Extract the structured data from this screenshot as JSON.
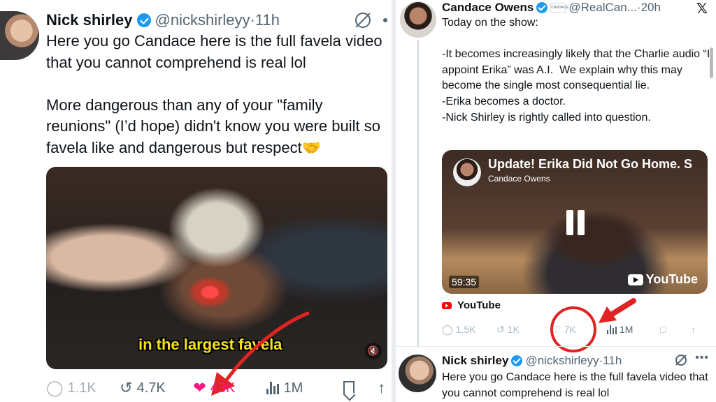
{
  "left_post": {
    "name": "Nick shirley",
    "handle": "@nickshirleyy",
    "time": "·11h",
    "text": "Here you go Candace here is the full favela video that you cannot comprehend is real lol\n\nMore dangerous than any of your \"family reunions\" (I’d hope) didn't know you were built so favela like and dangerous but respect🤝",
    "video_caption": "in the largest favela",
    "actions": {
      "replies": "1.1K",
      "reposts": "4.7K",
      "likes": "43K",
      "views": "1M"
    },
    "colors": {
      "like_active": "#f91880",
      "annotation_arrow": "#e02424"
    },
    "icons": [
      "grok-icon",
      "more-icon",
      "mute-icon",
      "reply-icon",
      "repost-icon",
      "heart-filled-icon",
      "views-icon",
      "bookmark-icon",
      "share-icon"
    ]
  },
  "right_post": {
    "name": "Candace Owens",
    "affiliate_badge": "CANDACE",
    "handle": "@RealCan...",
    "time": "·20h",
    "text": "Today on the show:\n\n-It becomes increasingly likely that the Charlie audio “I appoint Erika” was A.I.  We explain why this may become the single most consequential lie.\n-Erika becomes a doctor.\n-Nick Shirley is rightly called into question.",
    "video": {
      "title": "Update! Erika Did Not Go Home. S",
      "channel": "Candace Owens",
      "duration": "59:35",
      "brand": "YouTube"
    },
    "source": "YouTube",
    "actions": {
      "replies": "1.5K",
      "reposts": "1K",
      "likes": "7K",
      "views": "1M"
    },
    "annotation_color": "#e02424"
  },
  "reply_post": {
    "name": "Nick shirley",
    "handle": "@nickshirleyy",
    "time": "·11h",
    "text": "Here you go Candace here is the full favela video that you cannot comprehend is real lol"
  }
}
